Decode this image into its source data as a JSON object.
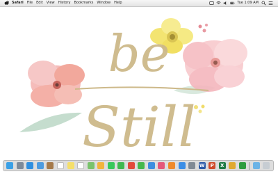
{
  "menubar": {
    "app_name": "Safari",
    "items": [
      "File",
      "Edit",
      "View",
      "History",
      "Bookmarks",
      "Window",
      "Help"
    ],
    "clock": "Tue 1:09 AM"
  },
  "wallpaper": {
    "text_line1": "be",
    "text_line2": "Still",
    "colors": {
      "gold": "#cdb98a",
      "pink": "#f4b3b8",
      "coral": "#ee9a8c",
      "yellow": "#f3e36a",
      "green": "#b7d4c2"
    }
  },
  "dock": {
    "icons": [
      {
        "name": "finder-icon",
        "color": "#3aa0e6"
      },
      {
        "name": "launchpad-icon",
        "color": "#7d8a99"
      },
      {
        "name": "safari-icon",
        "color": "#2f8fe0"
      },
      {
        "name": "mail-icon",
        "color": "#4c9be0"
      },
      {
        "name": "contacts-icon",
        "color": "#a57a4a"
      },
      {
        "name": "calendar-icon",
        "color": "#ffffff"
      },
      {
        "name": "notes-icon",
        "color": "#f5df6a"
      },
      {
        "name": "reminders-icon",
        "color": "#ffffff"
      },
      {
        "name": "maps-icon",
        "color": "#79c36b"
      },
      {
        "name": "photos-icon",
        "color": "#f2b43c"
      },
      {
        "name": "messages-icon",
        "color": "#38c85a"
      },
      {
        "name": "facetime-icon",
        "color": "#40b84f"
      },
      {
        "name": "chrome-icon",
        "color": "#e24a3b"
      },
      {
        "name": "numbers-icon",
        "color": "#46b84c"
      },
      {
        "name": "keynote-icon",
        "color": "#3c8ee0"
      },
      {
        "name": "itunes-icon",
        "color": "#e5577a"
      },
      {
        "name": "ibooks-icon",
        "color": "#ef8a2b"
      },
      {
        "name": "app-store-icon",
        "color": "#3c8ee6"
      },
      {
        "name": "system-preferences-icon",
        "color": "#808a95"
      },
      {
        "name": "word-icon",
        "color": "#2b5aa8",
        "glyph": "W"
      },
      {
        "name": "powerpoint-icon",
        "color": "#cf4a2a",
        "glyph": "P"
      },
      {
        "name": "excel-icon",
        "color": "#1f7a44",
        "glyph": "X"
      },
      {
        "name": "onenote-icon",
        "color": "#e0a92f"
      },
      {
        "name": "xbox-icon",
        "color": "#2e9c3f"
      },
      {
        "name": "downloads-folder-icon",
        "color": "#6bb3e6"
      },
      {
        "name": "trash-icon",
        "color": "#c7cdd3"
      }
    ]
  }
}
